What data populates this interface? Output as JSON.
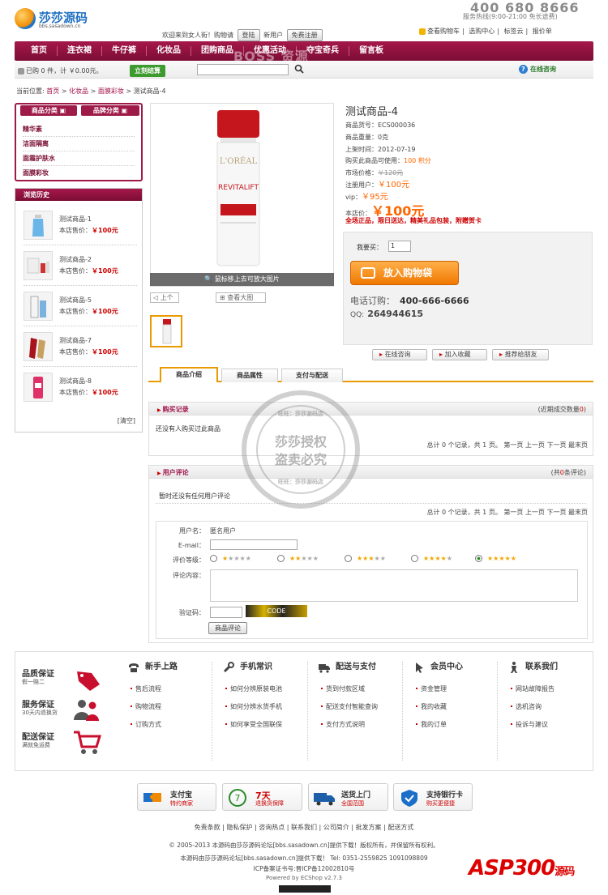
{
  "header": {
    "logo_title": "莎莎源码",
    "logo_sub": "bbs.sasadown.cn",
    "phone": "400 680 8666",
    "hotline": "服务热线(9:00-21:00 免长途费)",
    "welcome": "欢迎来到女人街！购物请",
    "login": "登陆",
    "newuser": "新用户",
    "register": "免费注册",
    "toplinks": [
      "查看购物车",
      "选购中心",
      "标签云",
      "报价单"
    ]
  },
  "nav": [
    "首页",
    "连衣裙",
    "牛仔裤",
    "化妆品",
    "团购商品",
    "优惠活动",
    "夺宝奇兵",
    "留言板"
  ],
  "watermark_top": "BOSS 资源",
  "subbar": {
    "cart": "已购 0 件，计 ￥0.00元。",
    "checkout": "立刻结算",
    "online": "在线咨询"
  },
  "breadcrumb": {
    "label": "当前位置:",
    "items": [
      "首页",
      "化妆品",
      "面膜彩妆"
    ],
    "current": "测试商品-4"
  },
  "categories": {
    "tab1": "商品分类",
    "tab2": "品牌分类",
    "items": [
      "精华素",
      "洁面隔离",
      "面霜护肤水",
      "面膜彩妆"
    ]
  },
  "history": {
    "title": "浏览历史",
    "price_label": "本店售价：",
    "clear": "[清空]",
    "items": [
      {
        "name": "测试商品-1",
        "price": "￥100元"
      },
      {
        "name": "测试商品-2",
        "price": "￥100元"
      },
      {
        "name": "测试商品-5",
        "price": "￥100元"
      },
      {
        "name": "测试商品-7",
        "price": "￥100元"
      },
      {
        "name": "测试商品-8",
        "price": "￥100元"
      }
    ]
  },
  "product": {
    "zoom_hint": "鼠标移上去可放大图片",
    "prev": "上个",
    "bigview": "查看大图",
    "title": "测试商品-4",
    "sku": "商品货号：ECS000036",
    "weight": "商品重量：0克",
    "date": "上架时间：2012-07-19",
    "points_label": "购买此商品可使用：",
    "points": "100 积分",
    "market_label": "市场价格：",
    "market": "￥120元",
    "reg_label": "注册用户：",
    "reg": "￥100元",
    "vip_label": "vip：",
    "vip": "￥95元",
    "shop_label": "本店价：",
    "shop": "￥100元",
    "promo": "全场正品，限日送达，精美礼品包装，附赠贺卡",
    "qty_label": "我要买：",
    "qty": "1",
    "addcart": "放入购物袋",
    "tel_label": "电话订购：",
    "tel": "400-666-6666",
    "qq_label": "QQ:",
    "qq": "264944615",
    "btn_consult": "在线咨询",
    "btn_fav": "加入收藏",
    "btn_share": "推荐给朋友"
  },
  "tabs": [
    "商品介绍",
    "商品属性",
    "支付与配送"
  ],
  "purchase": {
    "title": "购买记录",
    "right": "(近期成交数量",
    "count": "0",
    "right_end": ")",
    "empty": "还没有人购买过此商品",
    "pager": "总计 0 个记录，共 1 页。 第一页 上一页 下一页 最末页"
  },
  "comments": {
    "title": "用户评论",
    "right": "(共",
    "count": "0",
    "right_end": "条评论)",
    "empty": "暂时还没有任何用户评论",
    "pager": "总计 0 个记录，共 1 页。 第一页 上一页 下一页 最末页",
    "user_label": "用户名：",
    "user": "匿名用户",
    "email_label": "E-mail：",
    "rank_label": "评价等级：",
    "content_label": "评论内容：",
    "captcha_label": "验证码：",
    "captcha_img": "CODE",
    "submit": "商品评论"
  },
  "stamp": {
    "top": "旺旺：莎莎源码店",
    "l1": "莎莎授权",
    "l2": "盗卖必究",
    "bottom": "旺旺：莎莎源码店"
  },
  "guarantee": [
    {
      "t": "品质保证",
      "s": "假一赔二"
    },
    {
      "t": "服务保证",
      "s": "30天内退换货"
    },
    {
      "t": "配送保证",
      "s": "满就免运费"
    }
  ],
  "footcols": [
    {
      "h": "新手上路",
      "items": [
        "售后流程",
        "购物流程",
        "订购方式"
      ]
    },
    {
      "h": "手机常识",
      "items": [
        "如何分辨原装电池",
        "如何分辨水货手机",
        "如何享受全国联保"
      ]
    },
    {
      "h": "配送与支付",
      "items": [
        "货到付款区域",
        "配送支付智能查询",
        "支付方式说明"
      ]
    },
    {
      "h": "会员中心",
      "items": [
        "资金管理",
        "我的收藏",
        "我的订单"
      ]
    },
    {
      "h": "联系我们",
      "items": [
        "网站故障报告",
        "选机咨询",
        "投诉与建议"
      ]
    }
  ],
  "badges": [
    {
      "t": "支付宝",
      "s": "特约商家"
    },
    {
      "t": "7天",
      "s": "退换货保障"
    },
    {
      "t": "送货上门",
      "s": "全国范围"
    },
    {
      "t": "支持银行卡",
      "s": "购买更便捷"
    }
  ],
  "footlinks": "免责条款 | 隐私保护 | 咨询热点 | 联系我们 | 公司简介 | 批发方案 | 配送方式",
  "copyright": "© 2005-2013 本源码由莎莎源码论坛[bbs.sasadown.cn]提供下载！版权所有，并保留所有权利。",
  "contact": "本源码由莎莎源码论坛[bbs.sasadown.cn]提供下载！ Tel: 0351-2559825  1091098809",
  "icp": "ICP备案证书号:晋ICP备12002810号",
  "powered": "Powered by ECShop v2.7.3",
  "asp_logo": "ASP300",
  "asp_suffix": "源码"
}
